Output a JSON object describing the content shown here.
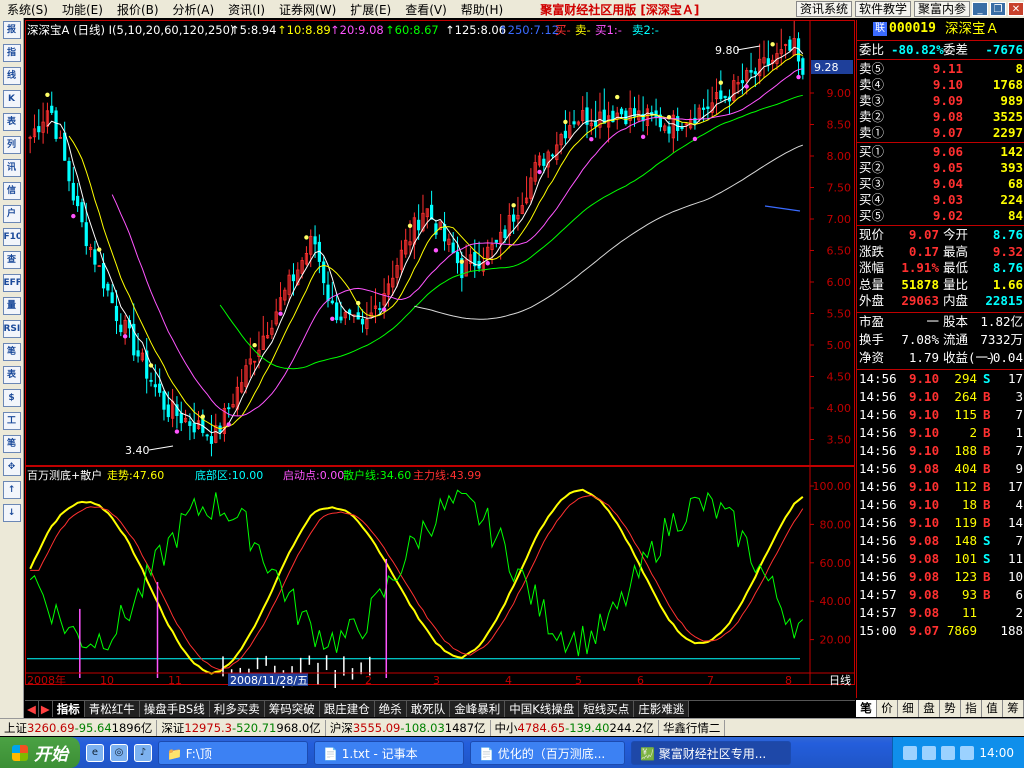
{
  "menu": {
    "items": [
      "系统(S)",
      "功能(E)",
      "报价(B)",
      "分析(A)",
      "资讯(I)",
      "证券网(W)",
      "扩展(E)",
      "查看(V)",
      "帮助(H)"
    ],
    "brand": "聚富财经社区用版 [深深宝Ａ]",
    "right_buttons": [
      "资讯系统",
      "软件教学",
      "聚富内参"
    ]
  },
  "toolbar": {
    "icons": [
      "quote-icon",
      "indicator-icon",
      "line-chart-icon",
      "kline-icon",
      "report-icon",
      "list-icon",
      "news-icon",
      "mail-icon",
      "users-icon",
      "f10-icon",
      "search-icon",
      "eff-icon",
      "vol-icon",
      "rsi-icon",
      "tick-icon",
      "table-icon",
      "dollar-icon",
      "tools-icon",
      "pencil-icon",
      "move-icon",
      "arrow-up-icon",
      "arrow-down-icon"
    ],
    "labels": [
      "报",
      "指",
      "线",
      "K",
      "表",
      "列",
      "讯",
      "信",
      "户",
      "F10",
      "查",
      "EFF",
      "量",
      "RSI",
      "笔",
      "表",
      "$",
      "工",
      "笔",
      "✥",
      "↑",
      "↓"
    ]
  },
  "chart_header": {
    "title": "深深宝A (日线) I(5,10,20,60,120,250)",
    "ma": [
      {
        "label": "↑5:8.94",
        "color": "#FFFFFF"
      },
      {
        "label": "↑10:8.89",
        "color": "#FFFF00"
      },
      {
        "label": "↑20:9.08",
        "color": "#FF55FF"
      },
      {
        "label": "↑60:8.67",
        "color": "#00FF00"
      },
      {
        "label": "↑125:8.06",
        "color": "#FFFFFF"
      },
      {
        "label": "↑250:7.12",
        "color": "#3A6BFF"
      }
    ],
    "signals": [
      {
        "label": "买-",
        "color": "#FF3030"
      },
      {
        "label": "卖-",
        "color": "#FFFF00"
      },
      {
        "label": "买1:-",
        "color": "#FF55FF"
      },
      {
        "label": "卖2:-",
        "color": "#00FFFF"
      }
    ]
  },
  "annotations": {
    "high": "9.80",
    "low": "3.40",
    "price_tag": "9.28"
  },
  "price_axis": [
    "9.00",
    "8.50",
    "8.00",
    "7.50",
    "7.00",
    "6.50",
    "6.00",
    "5.50",
    "5.00",
    "4.50",
    "4.00",
    "3.50"
  ],
  "indicator": {
    "name": "百万测底+散户",
    "values": [
      {
        "label": "走势:47.60",
        "color": "#FFFF00"
      },
      {
        "label": "底部区:10.00",
        "color": "#00FFFF"
      },
      {
        "label": "启动点:0.00",
        "color": "#FF55FF"
      },
      {
        "label": "散户线:34.60",
        "color": "#00FF00"
      },
      {
        "label": "主力线:43.99",
        "color": "#FF3030"
      }
    ],
    "axis": [
      "100.00",
      "80.00",
      "60.00",
      "40.00",
      "20.00"
    ]
  },
  "date_axis": {
    "labels": [
      "2008年",
      "10",
      "11",
      "2008/11/28/五",
      "2",
      "3",
      "4",
      "5",
      "6",
      "7",
      "8"
    ],
    "period": "日线"
  },
  "quote": {
    "code": "000019",
    "name": "深深宝Ａ",
    "weibi_label": "委比",
    "weibi": "-80.82%",
    "weicha_label": "委差",
    "weicha": "-7676",
    "asks": [
      {
        "label": "卖⑤",
        "price": "9.11",
        "vol": "8"
      },
      {
        "label": "卖④",
        "price": "9.10",
        "vol": "1768"
      },
      {
        "label": "卖③",
        "price": "9.09",
        "vol": "989"
      },
      {
        "label": "卖②",
        "price": "9.08",
        "vol": "3525"
      },
      {
        "label": "卖①",
        "price": "9.07",
        "vol": "2297"
      }
    ],
    "bids": [
      {
        "label": "买①",
        "price": "9.06",
        "vol": "142"
      },
      {
        "label": "买②",
        "price": "9.05",
        "vol": "393"
      },
      {
        "label": "买③",
        "price": "9.04",
        "vol": "68"
      },
      {
        "label": "买④",
        "price": "9.03",
        "vol": "224"
      },
      {
        "label": "买⑤",
        "price": "9.02",
        "vol": "84"
      }
    ],
    "stats": [
      {
        "l1": "现价",
        "v1": "9.07",
        "c1": "red",
        "l2": "今开",
        "v2": "8.76",
        "c2": "cyan"
      },
      {
        "l1": "涨跌",
        "v1": "0.17",
        "c1": "red",
        "l2": "最高",
        "v2": "9.32",
        "c2": "red"
      },
      {
        "l1": "涨幅",
        "v1": "1.91%",
        "c1": "red",
        "l2": "最低",
        "v2": "8.76",
        "c2": "cyan"
      },
      {
        "l1": "总量",
        "v1": "51878",
        "c1": "yel",
        "l2": "量比",
        "v2": "1.66",
        "c2": "yel"
      },
      {
        "l1": "外盘",
        "v1": "29063",
        "c1": "red",
        "l2": "内盘",
        "v2": "22815",
        "c2": "cyan"
      }
    ],
    "stats2": [
      {
        "l1": "市盈",
        "v1": "一",
        "l2": "股本",
        "v2": "1.82亿"
      },
      {
        "l1": "换手",
        "v1": "7.08%",
        "l2": "流通",
        "v2": "7332万"
      },
      {
        "l1": "净资",
        "v1": "1.79",
        "l2": "收益(一)",
        "v2": "-0.04"
      }
    ],
    "ticks": [
      {
        "t": "14:56",
        "p": "9.10",
        "v": "294",
        "d": "S",
        "n": "17",
        "pc": "red",
        "dc": "cyan"
      },
      {
        "t": "14:56",
        "p": "9.10",
        "v": "264",
        "d": "B",
        "n": "3",
        "pc": "red",
        "dc": "red"
      },
      {
        "t": "14:56",
        "p": "9.10",
        "v": "115",
        "d": "B",
        "n": "7",
        "pc": "red",
        "dc": "red"
      },
      {
        "t": "14:56",
        "p": "9.10",
        "v": "2",
        "d": "B",
        "n": "1",
        "pc": "red",
        "dc": "red"
      },
      {
        "t": "14:56",
        "p": "9.10",
        "v": "188",
        "d": "B",
        "n": "7",
        "pc": "red",
        "dc": "red"
      },
      {
        "t": "14:56",
        "p": "9.08",
        "v": "404",
        "d": "B",
        "n": "9",
        "pc": "red",
        "dc": "red"
      },
      {
        "t": "14:56",
        "p": "9.10",
        "v": "112",
        "d": "B",
        "n": "17",
        "pc": "red",
        "dc": "red"
      },
      {
        "t": "14:56",
        "p": "9.10",
        "v": "18",
        "d": "B",
        "n": "4",
        "pc": "red",
        "dc": "red"
      },
      {
        "t": "14:56",
        "p": "9.10",
        "v": "119",
        "d": "B",
        "n": "14",
        "pc": "red",
        "dc": "red"
      },
      {
        "t": "14:56",
        "p": "9.08",
        "v": "148",
        "d": "S",
        "n": "7",
        "pc": "red",
        "dc": "cyan"
      },
      {
        "t": "14:56",
        "p": "9.08",
        "v": "101",
        "d": "S",
        "n": "11",
        "pc": "red",
        "dc": "cyan"
      },
      {
        "t": "14:56",
        "p": "9.08",
        "v": "123",
        "d": "B",
        "n": "10",
        "pc": "red",
        "dc": "red"
      },
      {
        "t": "14:57",
        "p": "9.08",
        "v": "93",
        "d": "B",
        "n": "6",
        "pc": "red",
        "dc": "red"
      },
      {
        "t": "14:57",
        "p": "9.08",
        "v": "11",
        "d": "",
        "n": "2",
        "pc": "red",
        "dc": "red"
      },
      {
        "t": "15:00",
        "p": "9.07",
        "v": "7869",
        "d": "",
        "n": "188",
        "pc": "red",
        "dc": "mag"
      }
    ]
  },
  "tabs": [
    "指标",
    "青松红牛",
    "操盘手BS线",
    "利多买卖",
    "筹码突破",
    "跟庄建仓",
    "绝杀",
    "敢死队",
    "金峰暴利",
    "中国K线操盘",
    "短线买点",
    "庄影难逃"
  ],
  "right_tabs": [
    "笔",
    "价",
    "细",
    "盘",
    "势",
    "指",
    "值",
    "筹"
  ],
  "index_strip": [
    {
      "name": "上证",
      "val": "3260.69",
      "chg": "-95.64",
      "amt": "1896亿"
    },
    {
      "name": "深证",
      "val": "12975.3",
      "chg": "-520.71",
      "amt": "968.0亿"
    },
    {
      "name": "沪深",
      "val": "3555.09",
      "chg": "-108.03",
      "amt": "1487亿"
    },
    {
      "name": "中小",
      "val": "4784.65",
      "chg": "-139.40",
      "amt": "244.2亿"
    },
    {
      "name": "华鑫行情二",
      "val": "",
      "chg": "",
      "amt": ""
    }
  ],
  "taskbar": {
    "start": "开始",
    "windows": [
      "F:\\顶",
      "1.txt - 记事本",
      "优化的（百万测底...",
      "聚富财经社区专用..."
    ],
    "clock": "14:00"
  },
  "colors": {
    "up": "#FF3030",
    "down": "#00FFFF",
    "axis": "#C00000",
    "accent": "#FFFF00"
  }
}
